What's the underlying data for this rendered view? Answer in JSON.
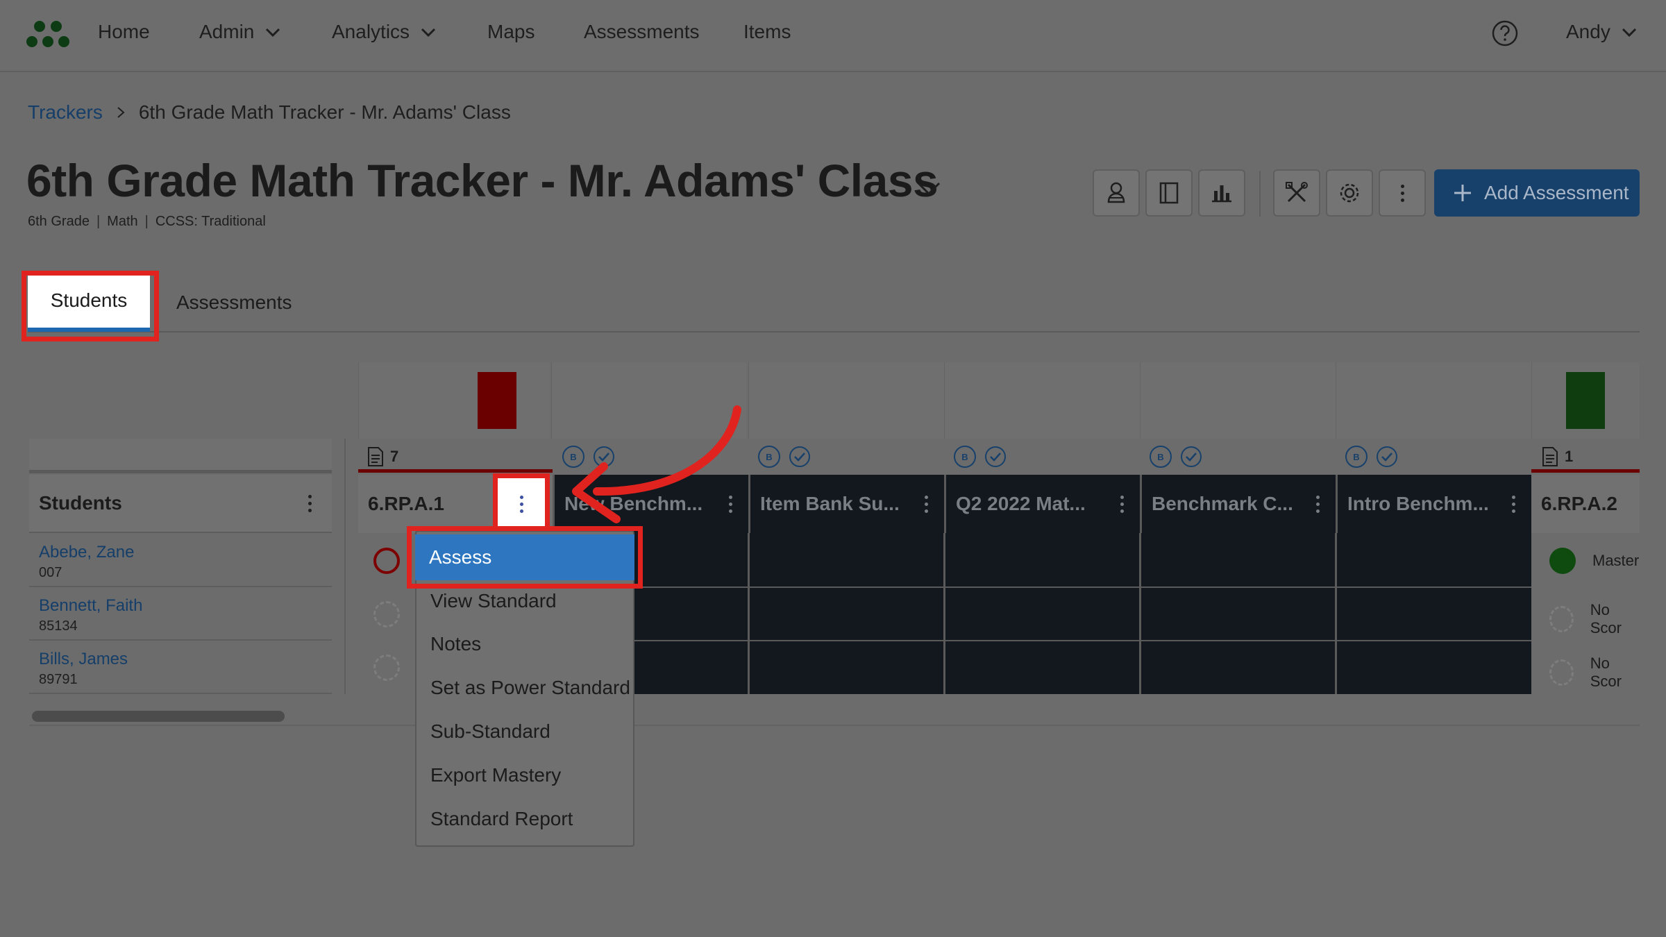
{
  "nav": {
    "home": "Home",
    "admin": "Admin",
    "analytics": "Analytics",
    "maps": "Maps",
    "assessments": "Assessments",
    "items": "Items",
    "user": "Andy"
  },
  "breadcrumb": {
    "root": "Trackers",
    "current": "6th Grade Math Tracker - Mr. Adams' Class"
  },
  "page": {
    "title": "6th Grade Math Tracker - Mr. Adams' Class",
    "subtitle": [
      "6th Grade",
      "Math",
      "CCSS: Traditional"
    ],
    "subtitle_sep": "|"
  },
  "toolbar": {
    "add_assessment": "Add Assessment"
  },
  "tabs": {
    "students": "Students",
    "assessments": "Assessments"
  },
  "grid": {
    "students_header": "Students",
    "students": [
      {
        "name": "Abebe, Zane",
        "id": "007"
      },
      {
        "name": "Bennett, Faith",
        "id": "85134"
      },
      {
        "name": "Bills, James",
        "id": "89791"
      }
    ],
    "columns": [
      {
        "label": "6.RP.A.1",
        "count": "7"
      },
      {
        "label": "New Benchm...",
        "badge": "B"
      },
      {
        "label": "Item Bank Su...",
        "badge": "B"
      },
      {
        "label": "Q2 2022 Mat...",
        "badge": "B"
      },
      {
        "label": "Benchmark C...",
        "badge": "B"
      },
      {
        "label": "Intro Benchm...",
        "badge": "B"
      },
      {
        "label": "6.RP.A.2",
        "count": "1"
      }
    ],
    "last_col_cells": [
      "Master",
      "No Scor",
      "No Scor"
    ]
  },
  "menu": {
    "items": [
      "Assess",
      "View Standard",
      "Notes",
      "Set as Power Standard",
      "Sub-Standard",
      "Export Mastery",
      "Standard Report"
    ]
  },
  "colors": {
    "primary": "#17406b",
    "highlight": "#e0231e",
    "menu_active": "#2e77c0",
    "tab_underline": "#1d67b1",
    "mastery_red": "#6a0000",
    "mastery_green": "#0f4a0f"
  }
}
